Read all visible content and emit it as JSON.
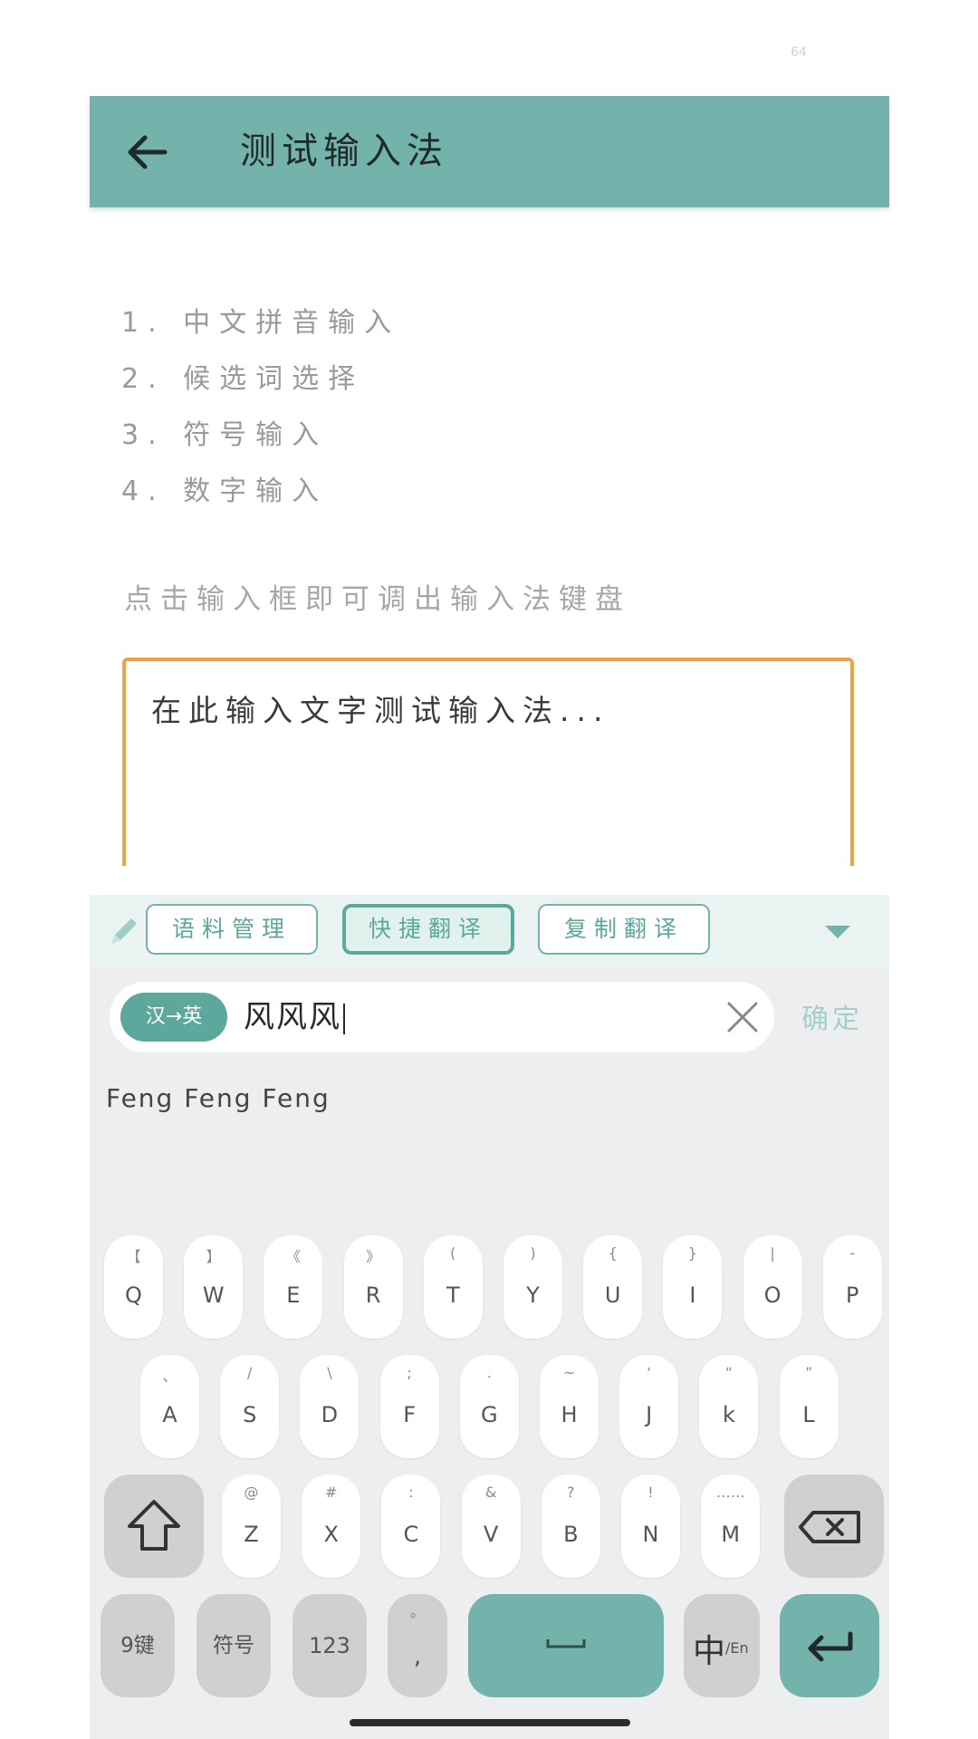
{
  "status": {
    "number": "64"
  },
  "header": {
    "title": "测试输入法"
  },
  "features": [
    "1. 中文拼音输入",
    "2. 候选词选择",
    "3. 符号输入",
    "4. 数字输入"
  ],
  "hint": "点击输入框即可调出输入法键盘",
  "text_area": {
    "placeholder": "在此输入文字测试输入法..."
  },
  "toolbar": {
    "corpus": "语料管理",
    "quick_translate": "快捷翻译",
    "copy_translate": "复制翻译"
  },
  "translate": {
    "direction": "汉→英",
    "input": "风风风",
    "confirm": "确定"
  },
  "candidate": "Feng Feng Feng",
  "keys": {
    "row1": [
      {
        "main": "Q",
        "sub": "【"
      },
      {
        "main": "W",
        "sub": "】"
      },
      {
        "main": "E",
        "sub": "《"
      },
      {
        "main": "R",
        "sub": "》"
      },
      {
        "main": "T",
        "sub": "("
      },
      {
        "main": "Y",
        "sub": ")"
      },
      {
        "main": "U",
        "sub": "{"
      },
      {
        "main": "I",
        "sub": "}"
      },
      {
        "main": "O",
        "sub": "|"
      },
      {
        "main": "P",
        "sub": "-"
      }
    ],
    "row2": [
      {
        "main": "A",
        "sub": "、"
      },
      {
        "main": "S",
        "sub": "/"
      },
      {
        "main": "D",
        "sub": "\\"
      },
      {
        "main": "F",
        "sub": ";"
      },
      {
        "main": "G",
        "sub": "."
      },
      {
        "main": "H",
        "sub": "~"
      },
      {
        "main": "J",
        "sub": "‘"
      },
      {
        "main": "k",
        "sub": "“"
      },
      {
        "main": "L",
        "sub": "”"
      }
    ],
    "row3": [
      {
        "main": "Z",
        "sub": "@"
      },
      {
        "main": "X",
        "sub": "#"
      },
      {
        "main": "C",
        "sub": ":"
      },
      {
        "main": "V",
        "sub": "&"
      },
      {
        "main": "B",
        "sub": "?"
      },
      {
        "main": "N",
        "sub": "!"
      },
      {
        "main": "M",
        "sub": "……"
      }
    ],
    "bottom": {
      "nine": "9键",
      "symbol": "符号",
      "num": "123",
      "comma": ",",
      "comma_sub": "。",
      "lang_main": "中",
      "lang_sub": "/En"
    }
  }
}
